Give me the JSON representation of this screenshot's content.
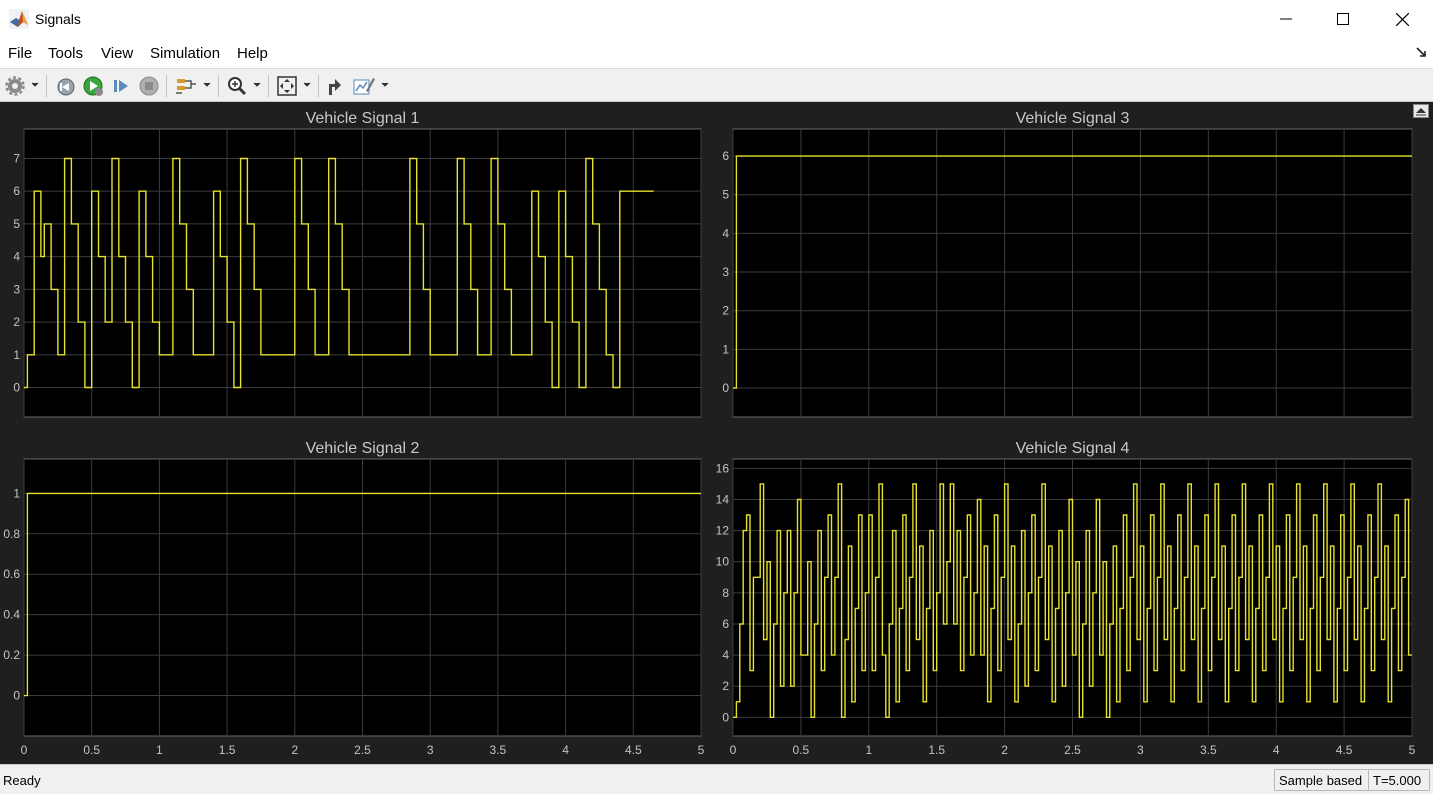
{
  "window": {
    "title": "Signals"
  },
  "menu": {
    "items": [
      "File",
      "Tools",
      "View",
      "Simulation",
      "Help"
    ]
  },
  "toolbar": {
    "icons": [
      "gear-icon",
      "step-back-icon",
      "run-icon",
      "step-forward-icon",
      "stop-icon",
      "signal-select-icon",
      "zoom-icon",
      "fit-to-view-icon",
      "restore-icon",
      "style-icon"
    ]
  },
  "status": {
    "text": "Ready",
    "mode": "Sample based",
    "time": "T=5.000"
  },
  "colors": {
    "signal": "#e6e12a",
    "axes_bg": "#000000",
    "figure_bg": "#1f1f1f",
    "grid": "#3c3c3c"
  },
  "chart_data": [
    {
      "type": "line",
      "title": "Vehicle Signal 1",
      "xlim": [
        0,
        5
      ],
      "ylim": [
        -0.9,
        7.9
      ],
      "xticks": [
        "0",
        "0.5",
        "1",
        "1.5",
        "2",
        "2.5",
        "3",
        "3.5",
        "4",
        "4.5",
        "5"
      ],
      "show_xticks": false,
      "yticks": [
        "0",
        "1",
        "2",
        "3",
        "4",
        "5",
        "6",
        "7"
      ],
      "step": 0.025,
      "values": [
        0,
        1,
        1,
        6,
        6,
        4,
        5,
        5,
        3,
        3,
        1,
        1,
        7,
        7,
        5,
        5,
        2,
        2,
        0,
        0,
        6,
        6,
        4,
        4,
        2,
        2,
        7,
        7,
        4,
        4,
        2,
        2,
        0,
        0,
        6,
        6,
        4,
        4,
        2,
        2,
        1,
        1,
        1,
        1,
        7,
        7,
        5,
        5,
        3,
        3,
        1,
        1,
        1,
        1,
        1,
        1,
        6,
        6,
        4,
        4,
        2,
        2,
        0,
        0,
        7,
        7,
        5,
        5,
        3,
        3,
        1,
        1,
        1,
        1,
        1,
        1,
        1,
        1,
        1,
        1,
        7,
        7,
        5,
        5,
        3,
        3,
        1,
        1,
        1,
        1,
        7,
        7,
        5,
        5,
        3,
        3,
        1,
        1,
        1,
        1,
        1,
        1,
        1,
        1,
        1,
        1,
        1,
        1,
        1,
        1,
        1,
        1,
        1,
        1,
        7,
        7,
        5,
        5,
        3,
        3,
        1,
        1,
        1,
        1,
        1,
        1,
        1,
        1,
        7,
        7,
        5,
        5,
        3,
        3,
        1,
        1,
        1,
        1,
        7,
        7,
        5,
        5,
        3,
        3,
        1,
        1,
        1,
        1,
        1,
        1,
        6,
        6,
        4,
        4,
        2,
        2,
        0,
        0,
        6,
        6,
        4,
        4,
        2,
        2,
        0,
        0,
        7,
        7,
        5,
        5,
        3,
        3,
        1,
        1,
        0,
        0,
        6,
        6,
        6,
        6,
        6,
        6,
        6,
        6,
        6,
        6
      ]
    },
    {
      "type": "line",
      "title": "Vehicle Signal 2",
      "xlim": [
        0,
        5
      ],
      "ylim": [
        -0.2,
        1.17
      ],
      "xticks": [
        "0",
        "0.5",
        "1",
        "1.5",
        "2",
        "2.5",
        "3",
        "3.5",
        "4",
        "4.5",
        "5"
      ],
      "show_xticks": true,
      "yticks": [
        "0",
        "0.2",
        "0.4",
        "0.6",
        "0.8",
        "1"
      ],
      "step": 0.025,
      "values": [
        0,
        1,
        1,
        1,
        1,
        1,
        1,
        1,
        1,
        1,
        1,
        1,
        1,
        1,
        1,
        1,
        1,
        1,
        1,
        1,
        1,
        1,
        1,
        1,
        1,
        1,
        1,
        1,
        1,
        1,
        1,
        1,
        1,
        1,
        1,
        1,
        1,
        1,
        1,
        1,
        1,
        1,
        1,
        1,
        1,
        1,
        1,
        1,
        1,
        1,
        1,
        1,
        1,
        1,
        1,
        1,
        1,
        1,
        1,
        1,
        1,
        1,
        1,
        1,
        1,
        1,
        1,
        1,
        1,
        1,
        1,
        1,
        1,
        1,
        1,
        1,
        1,
        1,
        1,
        1,
        1,
        1,
        1,
        1,
        1,
        1,
        1,
        1,
        1,
        1,
        1,
        1,
        1,
        1,
        1,
        1,
        1,
        1,
        1,
        1,
        1,
        1,
        1,
        1,
        1,
        1,
        1,
        1,
        1,
        1,
        1,
        1,
        1,
        1,
        1,
        1,
        1,
        1,
        1,
        1,
        1,
        1,
        1,
        1,
        1,
        1,
        1,
        1,
        1,
        1,
        1,
        1,
        1,
        1,
        1,
        1,
        1,
        1,
        1,
        1,
        1,
        1,
        1,
        1,
        1,
        1,
        1,
        1,
        1,
        1,
        1,
        1,
        1,
        1,
        1,
        1,
        1,
        1,
        1,
        1,
        1,
        1,
        1,
        1,
        1,
        1,
        1,
        1,
        1,
        1,
        1,
        1,
        1,
        1,
        1,
        1,
        1,
        1,
        1,
        1,
        1,
        1,
        1,
        1,
        1,
        1,
        1,
        1,
        1,
        1,
        1,
        1,
        1,
        1,
        1,
        1,
        1,
        1,
        1,
        1
      ]
    },
    {
      "type": "line",
      "title": "Vehicle Signal 3",
      "xlim": [
        0,
        5
      ],
      "ylim": [
        -0.75,
        6.7
      ],
      "xticks": [
        "0",
        "0.5",
        "1",
        "1.5",
        "2",
        "2.5",
        "3",
        "3.5",
        "4",
        "4.5",
        "5"
      ],
      "show_xticks": false,
      "yticks": [
        "0",
        "1",
        "2",
        "3",
        "4",
        "5",
        "6"
      ],
      "step": 0.025,
      "values": [
        0,
        6,
        6,
        6,
        6,
        6,
        6,
        6,
        6,
        6,
        6,
        6,
        6,
        6,
        6,
        6,
        6,
        6,
        6,
        6,
        6,
        6,
        6,
        6,
        6,
        6,
        6,
        6,
        6,
        6,
        6,
        6,
        6,
        6,
        6,
        6,
        6,
        6,
        6,
        6,
        6,
        6,
        6,
        6,
        6,
        6,
        6,
        6,
        6,
        6,
        6,
        6,
        6,
        6,
        6,
        6,
        6,
        6,
        6,
        6,
        6,
        6,
        6,
        6,
        6,
        6,
        6,
        6,
        6,
        6,
        6,
        6,
        6,
        6,
        6,
        6,
        6,
        6,
        6,
        6,
        6,
        6,
        6,
        6,
        6,
        6,
        6,
        6,
        6,
        6,
        6,
        6,
        6,
        6,
        6,
        6,
        6,
        6,
        6,
        6,
        6,
        6,
        6,
        6,
        6,
        6,
        6,
        6,
        6,
        6,
        6,
        6,
        6,
        6,
        6,
        6,
        6,
        6,
        6,
        6,
        6,
        6,
        6,
        6,
        6,
        6,
        6,
        6,
        6,
        6,
        6,
        6,
        6,
        6,
        6,
        6,
        6,
        6,
        6,
        6,
        6,
        6,
        6,
        6,
        6,
        6,
        6,
        6,
        6,
        6,
        6,
        6,
        6,
        6,
        6,
        6,
        6,
        6,
        6,
        6,
        6,
        6,
        6,
        6,
        6,
        6,
        6,
        6,
        6,
        6,
        6,
        6,
        6,
        6,
        6,
        6,
        6,
        6,
        6,
        6,
        6,
        6,
        6,
        6,
        6,
        6,
        6,
        6,
        6,
        6,
        6,
        6,
        6,
        6,
        6,
        6,
        6,
        6,
        6,
        6
      ]
    },
    {
      "type": "line",
      "title": "Vehicle Signal 4",
      "xlim": [
        0,
        5
      ],
      "ylim": [
        -1.2,
        16.6
      ],
      "xticks": [
        "0",
        "0.5",
        "1",
        "1.5",
        "2",
        "2.5",
        "3",
        "3.5",
        "4",
        "4.5",
        "5"
      ],
      "show_xticks": true,
      "yticks": [
        "0",
        "2",
        "4",
        "6",
        "8",
        "10",
        "12",
        "14",
        "16"
      ],
      "step": 0.025,
      "values": [
        0,
        1,
        6,
        12,
        13,
        3,
        9,
        9,
        15,
        5,
        10,
        0,
        6,
        12,
        2,
        8,
        12,
        2,
        8,
        14,
        4,
        4,
        10,
        0,
        6,
        12,
        3,
        9,
        13,
        4,
        9,
        15,
        0,
        5,
        11,
        1,
        7,
        13,
        3,
        8,
        13,
        3,
        9,
        15,
        4,
        0,
        6,
        12,
        1,
        7,
        13,
        3,
        9,
        15,
        5,
        11,
        1,
        7,
        12,
        3,
        8,
        15,
        6,
        10,
        15,
        6,
        12,
        3,
        9,
        13,
        4,
        8,
        14,
        4,
        11,
        1,
        7,
        13,
        3,
        9,
        15,
        5,
        11,
        1,
        6,
        12,
        2,
        8,
        13,
        3,
        9,
        15,
        5,
        11,
        1,
        7,
        12,
        2,
        8,
        14,
        4,
        10,
        0,
        6,
        12,
        2,
        8,
        14,
        4,
        10,
        0,
        6,
        11,
        1,
        7,
        13,
        3,
        9,
        15,
        5,
        11,
        1,
        7,
        13,
        3,
        9,
        15,
        5,
        11,
        1,
        7,
        13,
        3,
        9,
        15,
        5,
        11,
        1,
        7,
        13,
        3,
        9,
        15,
        5,
        11,
        1,
        7,
        13,
        3,
        9,
        15,
        5,
        11,
        1,
        7,
        13,
        3,
        9,
        15,
        5,
        11,
        1,
        7,
        13,
        3,
        9,
        15,
        5,
        11,
        1,
        7,
        13,
        3,
        9,
        15,
        5,
        11,
        1,
        7,
        13,
        3,
        9,
        15,
        5,
        11,
        1,
        7,
        13,
        3,
        9,
        15,
        5,
        11,
        1,
        7,
        13,
        3,
        9,
        14,
        4
      ]
    }
  ]
}
